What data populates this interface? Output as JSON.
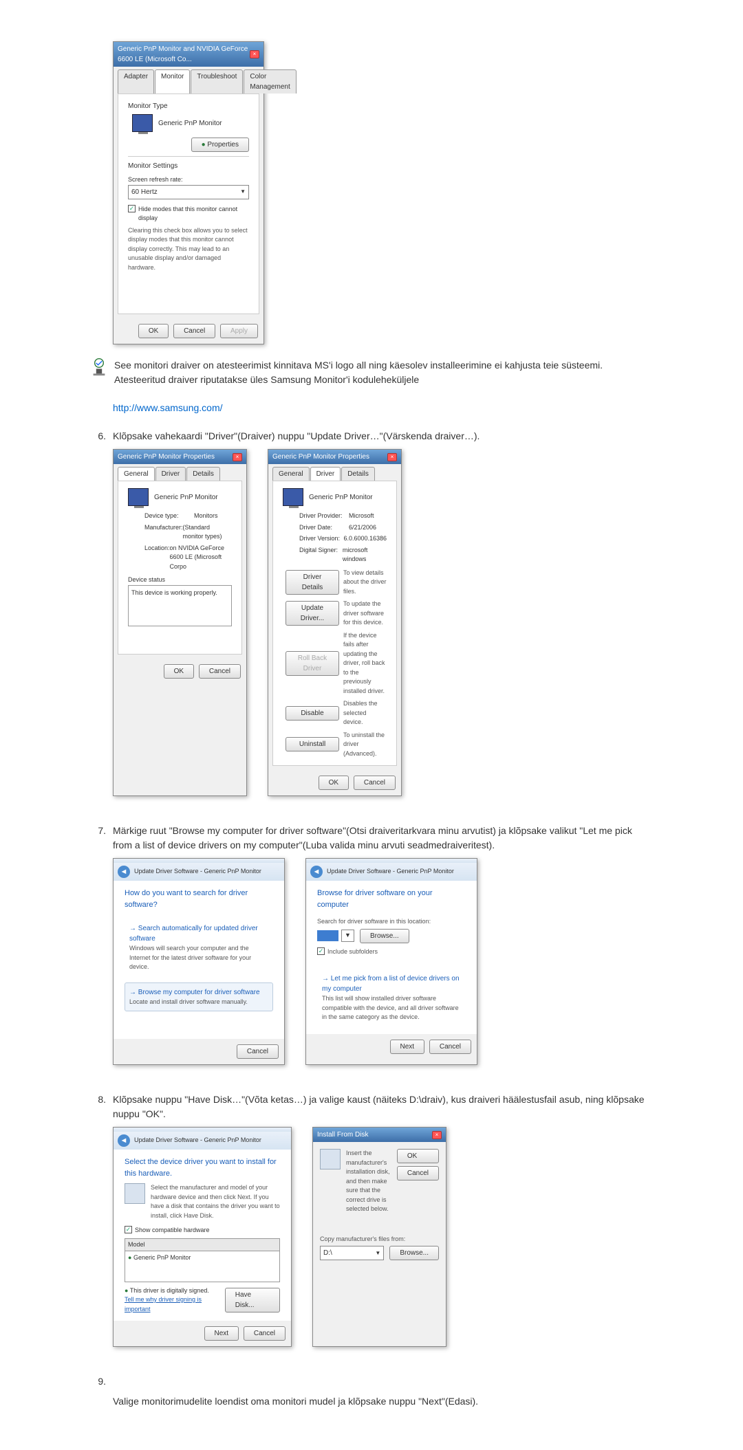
{
  "dlg1": {
    "title": "Generic PnP Monitor and NVIDIA GeForce 6600 LE (Microsoft Co...",
    "tabs": {
      "adapter": "Adapter",
      "monitor": "Monitor",
      "troubleshoot": "Troubleshoot",
      "color": "Color Management"
    },
    "monitor_type": "Monitor Type",
    "monitor_name": "Generic PnP Monitor",
    "properties": "Properties",
    "monitor_settings": "Monitor Settings",
    "refresh_label": "Screen refresh rate:",
    "refresh_value": "60 Hertz",
    "hide_modes": "Hide modes that this monitor cannot display",
    "hide_desc": "Clearing this check box allows you to select display modes that this monitor cannot display correctly. This may lead to an unusable display and/or damaged hardware.",
    "ok": "OK",
    "cancel": "Cancel",
    "apply": "Apply"
  },
  "note": {
    "line1": "See monitori draiver on atesteerimist kinnitava MS'i logo all ning käesolev installeerimine ei kahjusta teie süsteemi.",
    "line2": "Atesteeritud draiver riputatakse üles Samsung Monitor'i koduleheküljele"
  },
  "samsung_url": "http://www.samsung.com/",
  "step6_num": "6.",
  "step6_text": "Klõpsake vahekaardi \"Driver\"(Draiver) nuppu \"Update Driver…\"(Värskenda draiver…).",
  "dlg2": {
    "title": "Generic PnP Monitor Properties",
    "tabs": {
      "general": "General",
      "driver": "Driver",
      "details": "Details"
    },
    "name": "Generic PnP Monitor",
    "device_type_l": "Device type:",
    "device_type_v": "Monitors",
    "manufacturer_l": "Manufacturer:",
    "manufacturer_v": "(Standard monitor types)",
    "location_l": "Location:",
    "location_v": "on NVIDIA GeForce 6600 LE (Microsoft Corpo",
    "status_label": "Device status",
    "status_text": "This device is working properly.",
    "ok": "OK",
    "cancel": "Cancel"
  },
  "dlg3": {
    "title": "Generic PnP Monitor Properties",
    "tabs": {
      "general": "General",
      "driver": "Driver",
      "details": "Details"
    },
    "name": "Generic PnP Monitor",
    "provider_l": "Driver Provider:",
    "provider_v": "Microsoft",
    "date_l": "Driver Date:",
    "date_v": "6/21/2006",
    "version_l": "Driver Version:",
    "version_v": "6.0.6000.16386",
    "signer_l": "Digital Signer:",
    "signer_v": "microsoft windows",
    "b_details": "Driver Details",
    "b_details_d": "To view details about the driver files.",
    "b_update": "Update Driver...",
    "b_update_d": "To update the driver software for this device.",
    "b_rollback": "Roll Back Driver",
    "b_rollback_d": "If the device fails after updating the driver, roll back to the previously installed driver.",
    "b_disable": "Disable",
    "b_disable_d": "Disables the selected device.",
    "b_uninstall": "Uninstall",
    "b_uninstall_d": "To uninstall the driver (Advanced).",
    "ok": "OK",
    "cancel": "Cancel"
  },
  "step7_num": "7.",
  "step7_text": "Märkige ruut \"Browse my computer for driver software\"(Otsi draiveritarkvara minu arvutist) ja klõpsake valikut \"Let me pick from a list of device drivers on my computer\"(Luba valida minu arvuti seadmedraiveritest).",
  "dlg4": {
    "crumb": "Update Driver Software - Generic PnP Monitor",
    "heading": "How do you want to search for driver software?",
    "opt1_t": "Search automatically for updated driver software",
    "opt1_d": "Windows will search your computer and the Internet for the latest driver software for your device.",
    "opt2_t": "Browse my computer for driver software",
    "opt2_d": "Locate and install driver software manually.",
    "cancel": "Cancel"
  },
  "dlg5": {
    "crumb": "Update Driver Software - Generic PnP Monitor",
    "heading": "Browse for driver software on your computer",
    "search_l": "Search for driver software in this location:",
    "browse": "Browse...",
    "include_sub": "Include subfolders",
    "opt_t": "Let me pick from a list of device drivers on my computer",
    "opt_d": "This list will show installed driver software compatible with the device, and all driver software in the same category as the device.",
    "next": "Next",
    "cancel": "Cancel"
  },
  "step8_num": "8.",
  "step8_text": "Klõpsake nuppu \"Have Disk…\"(Võta ketas…) ja valige kaust (näiteks D:\\draiv), kus draiveri häälestusfail asub, ning klõpsake nuppu \"OK\".",
  "dlg6": {
    "crumb": "Update Driver Software - Generic PnP Monitor",
    "heading": "Select the device driver you want to install for this hardware.",
    "desc": "Select the manufacturer and model of your hardware device and then click Next. If you have a disk that contains the driver you want to install, click Have Disk.",
    "show_compat": "Show compatible hardware",
    "model": "Model",
    "model_item": "Generic PnP Monitor",
    "signed": "This driver is digitally signed.",
    "tell_me": "Tell me why driver signing is important",
    "have_disk": "Have Disk...",
    "next": "Next",
    "cancel": "Cancel"
  },
  "dlg7": {
    "title": "Install From Disk",
    "desc": "Insert the manufacturer's installation disk, and then make sure that the correct drive is selected below.",
    "ok": "OK",
    "cancel": "Cancel",
    "copy_from": "Copy manufacturer's files from:",
    "path": "D:\\",
    "browse": "Browse..."
  },
  "step9_num": "9.",
  "step9_text": "Valige monitorimudelite loendist oma monitori mudel ja klõpsake nuppu \"Next\"(Edasi)."
}
